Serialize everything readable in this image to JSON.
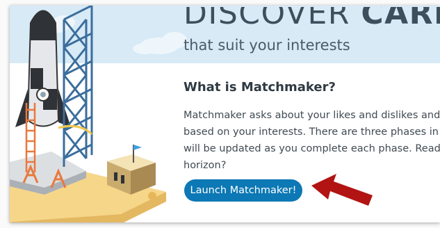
{
  "banner": {
    "headline_light": "DISCOVER ",
    "headline_bold": "CAREERS",
    "subtitle": "that suit your interests"
  },
  "section": {
    "title": "What is Matchmaker?",
    "description_lines": [
      "Matchmaker asks about your likes and dislikes and th",
      "based on your interests. There are three phases in th",
      "will be updated as you complete each phase. Ready t",
      "horizon?"
    ]
  },
  "launch_button": {
    "label": "Launch Matchmaker!"
  },
  "colors": {
    "banner_bg": "#d7eaf6",
    "button_bg": "#0c78b5",
    "arrow": "#b21313",
    "tower": "#3b6e9c"
  },
  "icons": [
    "rocket-launch-illustration",
    "red-arrow-annotation"
  ]
}
